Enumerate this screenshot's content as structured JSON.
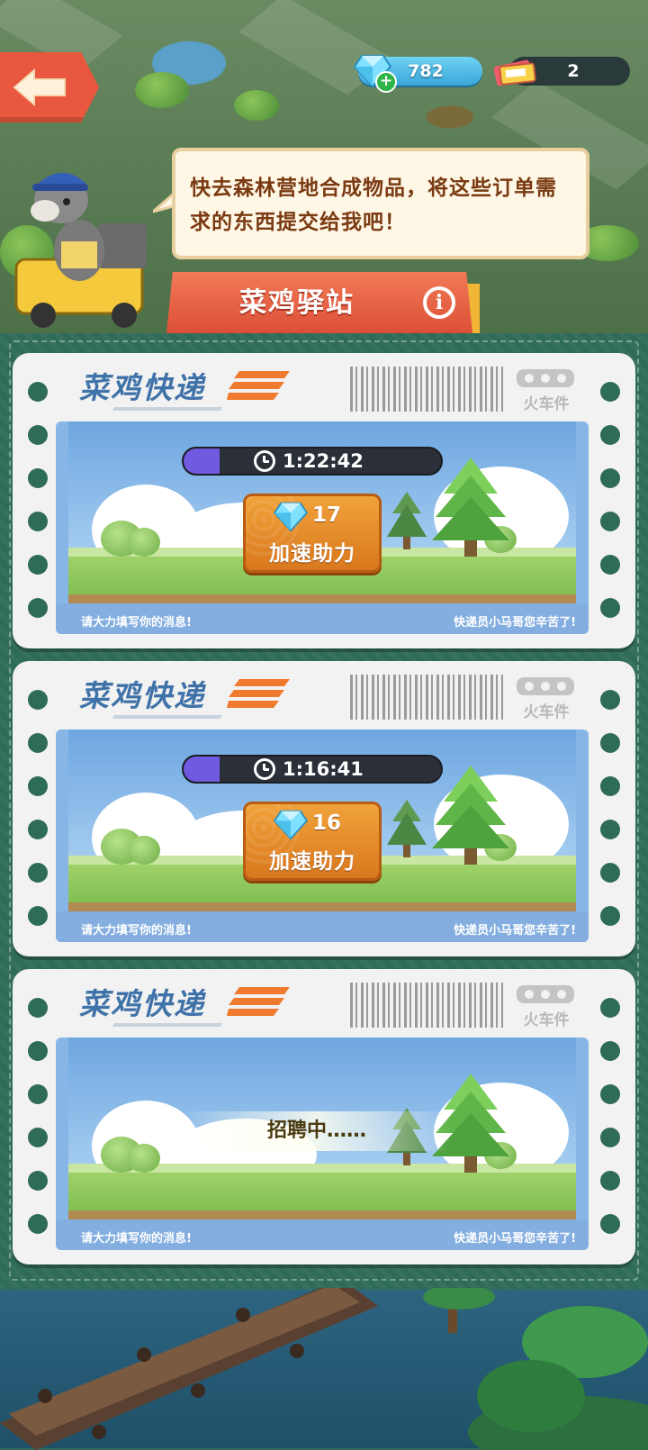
{
  "header": {
    "gem_count": "782",
    "ticket_count": "2",
    "speech": "快去森林营地合成物品，将这些订单需求的东西提交给我吧！",
    "station_title": "菜鸡驿站"
  },
  "cards": [
    {
      "brand": "菜鸡快递",
      "type": "火车件",
      "timer": "1:22:42",
      "timer_progress": 0.14,
      "speedup_cost": "17",
      "speedup_label": "加速助力",
      "footer_left": "请大力填写你的消息!",
      "footer_right": "快递员小马哥您辛苦了!"
    },
    {
      "brand": "菜鸡快递",
      "type": "火车件",
      "timer": "1:16:41",
      "timer_progress": 0.14,
      "speedup_cost": "16",
      "speedup_label": "加速助力",
      "footer_left": "请大力填写你的消息!",
      "footer_right": "快递员小马哥您辛苦了!"
    },
    {
      "brand": "菜鸡快递",
      "type": "火车件",
      "status": "招聘中……",
      "footer_left": "请大力填写你的消息!",
      "footer_right": "快递员小马哥您辛苦了!"
    }
  ],
  "colors": {
    "accent_orange": "#e8573e",
    "brand_blue": "#3f72a8",
    "panel_green": "#2f6b59",
    "button_orange": "#f0a23a"
  },
  "icons": [
    "back-arrow-icon",
    "gem-icon",
    "gem-plus-icon",
    "ticket-icon",
    "info-icon",
    "clock-icon",
    "speedup-gem-icon",
    "cat-logo-icon"
  ]
}
